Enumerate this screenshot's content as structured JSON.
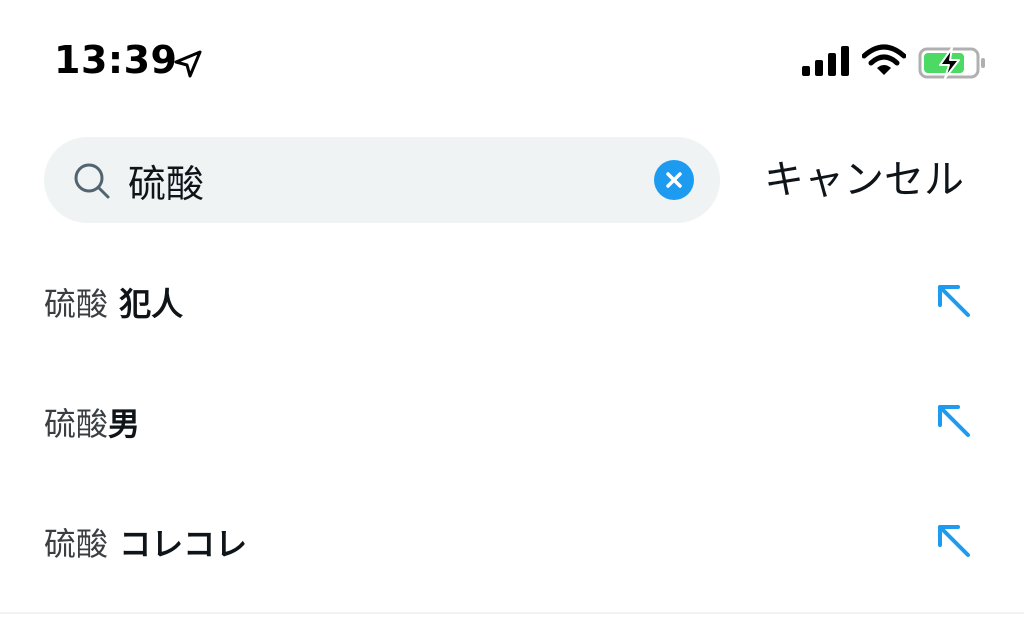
{
  "status_bar": {
    "time": "13:39",
    "icons": [
      "location-arrow-icon",
      "signal-bars-icon",
      "wifi-icon",
      "battery-charging-icon"
    ]
  },
  "search": {
    "value": "硫酸",
    "placeholder": "",
    "cancel_label": "キャンセル"
  },
  "suggestions": [
    {
      "prefix": "硫酸",
      "rest": " 犯人"
    },
    {
      "prefix": "硫酸",
      "rest": "男"
    },
    {
      "prefix": "硫酸",
      "rest": " コレコレ"
    }
  ],
  "colors": {
    "accent": "#1d9bf0",
    "search_bg": "#eff3f4",
    "text": "#0f1419",
    "battery_green": "#4cd964"
  }
}
